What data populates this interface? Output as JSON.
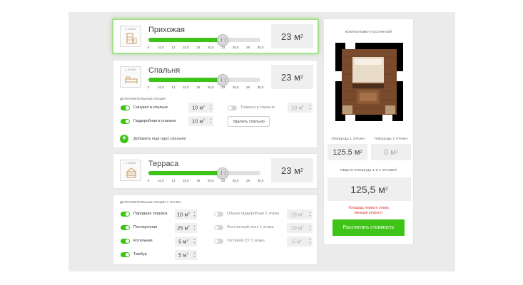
{
  "rooms": [
    {
      "floor_label": "1 ЭТАЖ",
      "name": "Прихожая",
      "area_value": "23 м",
      "area_sup": "2",
      "slider_fraction": 0.66,
      "ticks": [
        "6",
        "10,5",
        "13",
        "15,5",
        "18",
        "20,5",
        "23",
        "25,5",
        "28",
        "30,5"
      ]
    },
    {
      "floor_label": "1 ЭТАЖ",
      "name": "Спальня",
      "area_value": "23 м",
      "area_sup": "2",
      "slider_fraction": 0.66,
      "ticks": [
        "6",
        "10,5",
        "13",
        "15,5",
        "18",
        "20,5",
        "23",
        "25,5",
        "28",
        "30,5"
      ]
    },
    {
      "floor_label": "1 ЭТАЖ",
      "name": "Терраса",
      "area_value": "23 м",
      "area_sup": "2",
      "slider_fraction": 0.66,
      "ticks": [
        "6",
        "10,5",
        "13",
        "15,5",
        "18",
        "20,5",
        "23",
        "25,5",
        "28",
        "30,5"
      ]
    }
  ],
  "bedroom_options": {
    "title": "ДОПОЛНИТЕЛЬНЫЕ ОПЦИИ",
    "items": [
      {
        "label": "Санузел в спальне",
        "value": "10 м",
        "sup": "2",
        "on": true
      },
      {
        "label": "Гардеробная в спальне",
        "value": "10 м",
        "sup": "2",
        "on": true
      },
      {
        "label": "Терраса в спальне",
        "value": "10 м",
        "sup": "2",
        "on": false
      }
    ],
    "delete_label": "Удалить спальню",
    "add_label": "Добавить ещё одну спальню"
  },
  "floor_options": {
    "title": "ДОПОЛНИТЕЛЬНЫЕ ОПЦИИ 1 ЭТАЖА",
    "left": [
      {
        "label": "Парадная терраса",
        "value": "10 м",
        "sup": "2",
        "on": true
      },
      {
        "label": "Постирочная",
        "value": "25 м",
        "sup": "2",
        "on": true
      },
      {
        "label": "Котельная",
        "value": "5 м",
        "sup": "2",
        "on": true
      },
      {
        "label": "Тамбур",
        "value": "5 м",
        "sup": "2",
        "on": true
      }
    ],
    "right": [
      {
        "label": "Общая гардеробная 1 этажа",
        "value": "10 м",
        "sup": "2",
        "on": false
      },
      {
        "label": "Лестничный холл 1 этажа",
        "value": "10 м",
        "sup": "2",
        "on": false
      },
      {
        "label": "Гостевой СУ 1 этажа",
        "value": "5 м",
        "sup": "2",
        "on": false
      }
    ]
  },
  "summary": {
    "layout_title": "КОМПОНОВКА ГОСТИННОЙ",
    "floor1_title": "ПЛОЩАДЬ 1 ЭТАЖА",
    "floor2_title": "ПЛОЩАДЬ 2 ЭТАЖА",
    "floor1_value": "125.5 м",
    "floor1_sup": "2",
    "floor2_value": "0 м",
    "floor2_sup": "2",
    "total_title": "ОБЩАЯ ПЛОЩАДЬ 1 И 2 ЭТАЖЕЙ",
    "total_value": "125,5 м",
    "total_sup": "2",
    "warning_line1": "Площадь первого этажа",
    "warning_line2": "меньше второго!",
    "calc_button": "Рассчитать стоимость"
  },
  "colors": {
    "accent": "#3ec419",
    "warning": "#e0302a",
    "panel_bg": "#ebebeb"
  }
}
